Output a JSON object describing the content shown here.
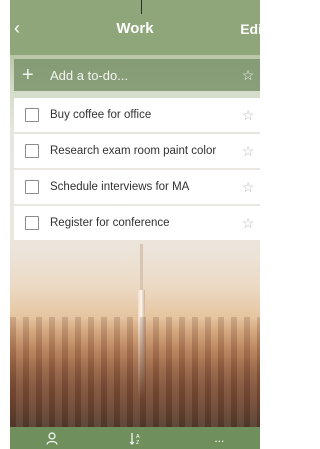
{
  "header": {
    "title": "Work",
    "edit_label": "Edi"
  },
  "add_row": {
    "placeholder": "Add a to-do..."
  },
  "todos": [
    {
      "label": "Buy coffee for office",
      "checked": false,
      "starred": false
    },
    {
      "label": "Research exam room paint color",
      "checked": false,
      "starred": false
    },
    {
      "label": "Schedule interviews for MA",
      "checked": false,
      "starred": false
    },
    {
      "label": "Register for conference",
      "checked": false,
      "starred": false
    }
  ],
  "footer": {
    "more_label": "..."
  },
  "icons": {
    "back": "chevron-left-icon",
    "add": "plus-icon",
    "star": "star-icon",
    "share": "person-icon",
    "sort": "sort-az-icon"
  },
  "colors": {
    "header": "#8fa67a",
    "footer": "#6f8f5d",
    "add_row": "#7a9169"
  }
}
